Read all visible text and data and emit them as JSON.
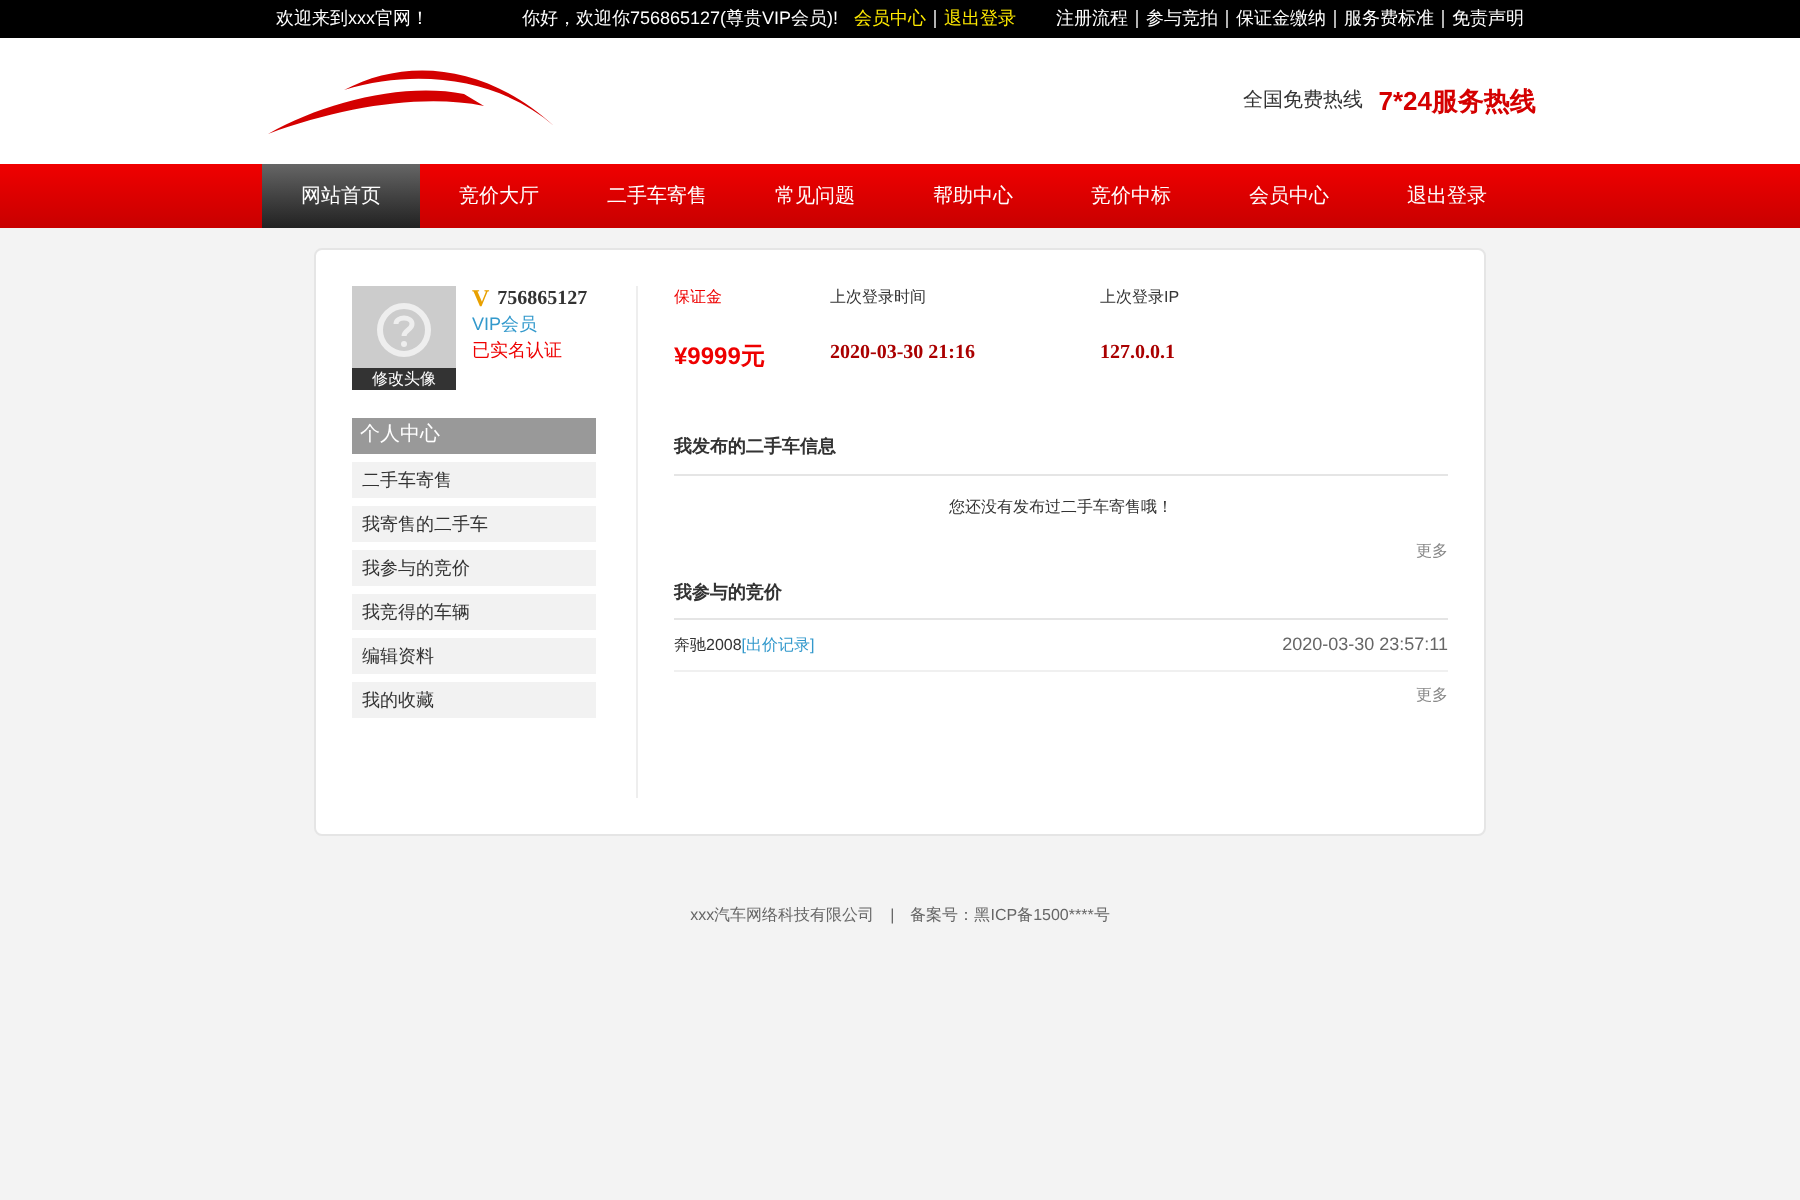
{
  "top_bar": {
    "welcome": "欢迎来到xxx官网！",
    "greeting": "你好，欢迎你756865127(尊贵VIP会员)!",
    "user_links": [
      "会员中心",
      "退出登录"
    ],
    "links": [
      "注册流程",
      "参与竞拍",
      "保证金缴纳",
      "服务费标准",
      "免责声明"
    ]
  },
  "header": {
    "hotline_label": "全国免费热线",
    "hotline": "7*24服务热线"
  },
  "nav": [
    {
      "label": "网站首页",
      "selected": true
    },
    {
      "label": "竞价大厅",
      "selected": false
    },
    {
      "label": "二手车寄售",
      "selected": false
    },
    {
      "label": "常见问题",
      "selected": false
    },
    {
      "label": "帮助中心",
      "selected": false
    },
    {
      "label": "竞价中标",
      "selected": false
    },
    {
      "label": "会员中心",
      "selected": false
    },
    {
      "label": "退出登录",
      "selected": false
    }
  ],
  "profile": {
    "badge": "V",
    "user_id": "756865127",
    "level": "VIP会员",
    "verified": "已实名认证",
    "avatar_button": "修改头像"
  },
  "sidebar": {
    "title": "个人中心",
    "items": [
      "二手车寄售",
      "我寄售的二手车",
      "我参与的竞价",
      "我竞得的车辆",
      "编辑资料",
      "我的收藏"
    ]
  },
  "stats": [
    {
      "label": "保证金",
      "value": "¥9999元",
      "kind": "money"
    },
    {
      "label": "上次登录时间",
      "value": "2020-03-30 21:16",
      "kind": "plain"
    },
    {
      "label": "上次登录IP",
      "value": "127.0.0.1",
      "kind": "plain"
    }
  ],
  "sections": [
    {
      "title": "我发布的二手车信息",
      "empty_text": "您还没有发布过二手车寄售哦！",
      "more": "更多"
    },
    {
      "title": "我参与的竞价",
      "rows": [
        {
          "name": "奔驰2008",
          "link": "[出价记录]",
          "time": "2020-03-30 23:57:11"
        }
      ],
      "more": "更多"
    }
  ],
  "footer": {
    "company": "xxx汽车网络科技有限公司",
    "separator": "|",
    "icp": "备案号：黑ICP备1500****号"
  }
}
